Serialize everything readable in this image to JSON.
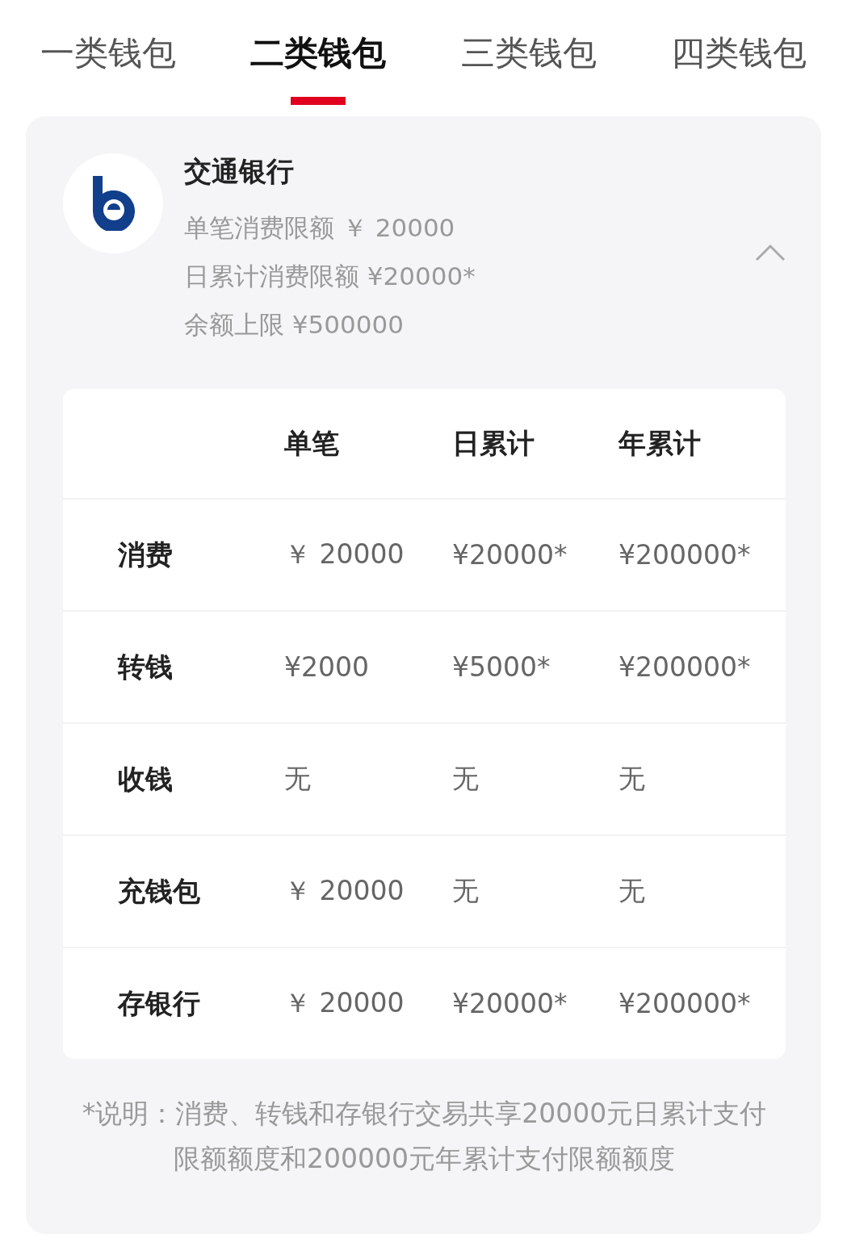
{
  "tabs": [
    {
      "label": "一类钱包",
      "selected": false
    },
    {
      "label": "二类钱包",
      "selected": true
    },
    {
      "label": "三类钱包",
      "selected": false
    },
    {
      "label": "四类钱包",
      "selected": false
    }
  ],
  "bank": {
    "name": "交通银行",
    "details": [
      "单笔消费限额 ￥ 20000",
      "日累计消费限额 ¥20000*",
      "余额上限 ¥500000"
    ],
    "expanded": true
  },
  "table": {
    "columns": [
      "单笔",
      "日累计",
      "年累计"
    ],
    "rows": [
      {
        "label": "消费",
        "cells": [
          "￥ 20000",
          "¥20000*",
          "¥200000*"
        ]
      },
      {
        "label": "转钱",
        "cells": [
          "¥2000",
          "¥5000*",
          "¥200000*"
        ]
      },
      {
        "label": "收钱",
        "cells": [
          "无",
          "无",
          "无"
        ]
      },
      {
        "label": "充钱包",
        "cells": [
          "￥ 20000",
          "无",
          "无"
        ]
      },
      {
        "label": "存银行",
        "cells": [
          "￥ 20000",
          "¥20000*",
          "¥200000*"
        ]
      }
    ]
  },
  "note": "*说明：消费、转钱和存银行交易共享20000元日累计支付限额额度和200000元年累计支付限额额度"
}
